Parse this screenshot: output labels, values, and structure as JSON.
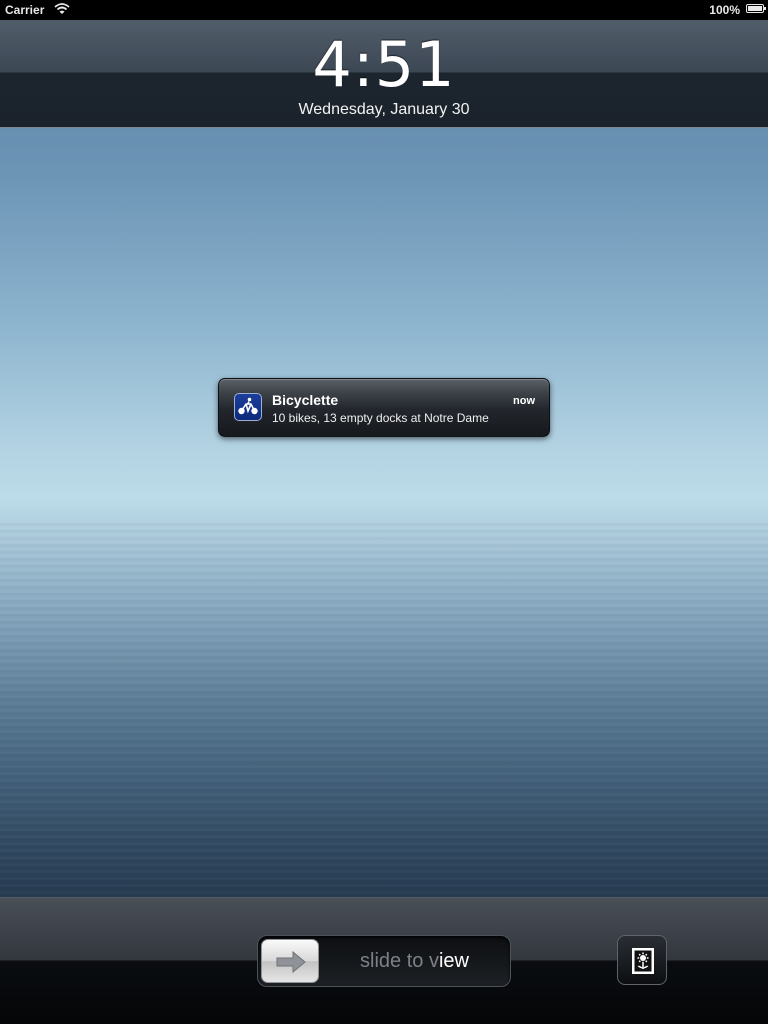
{
  "status_bar": {
    "carrier": "Carrier",
    "wifi_icon": "wifi-icon",
    "battery_percent": "100%",
    "battery_icon": "battery-icon"
  },
  "lock_screen": {
    "time": "4:51",
    "date": "Wednesday, January 30"
  },
  "notification": {
    "app_icon": "bicycle-icon",
    "app_name": "Bicyclette",
    "message": "10 bikes, 13 empty docks at Notre Dame",
    "timestamp": "now"
  },
  "bottom_bar": {
    "slider": {
      "knob_icon": "arrow-right-icon",
      "label_prefix": "slide to v",
      "label_highlight": "iew"
    },
    "photo_frame_icon": "photo-frame-icon"
  },
  "colors": {
    "notification_icon_bg": "#1c3f9c",
    "slider_text": "#7d8187"
  }
}
